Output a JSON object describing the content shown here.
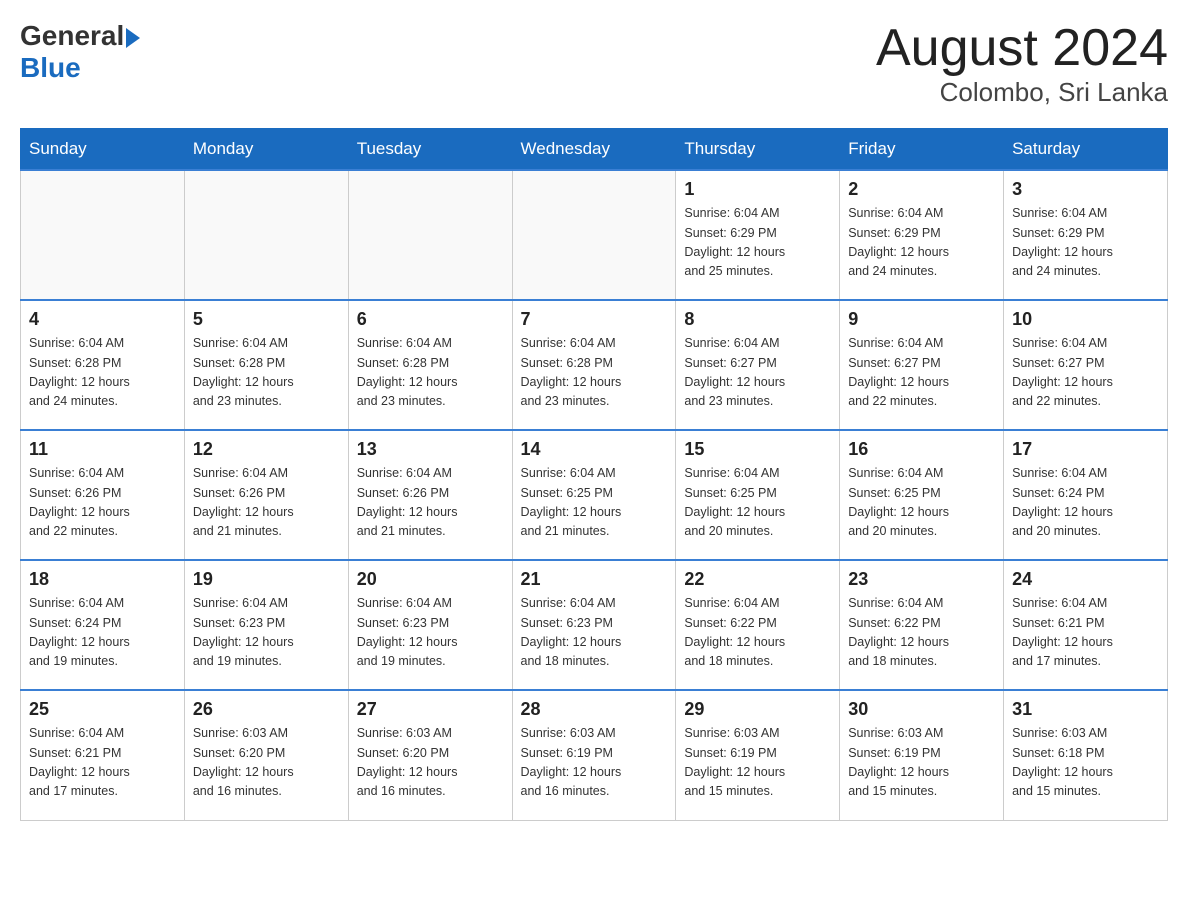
{
  "header": {
    "logo_general": "General",
    "logo_blue": "Blue",
    "title": "August 2024",
    "location": "Colombo, Sri Lanka"
  },
  "days_of_week": [
    "Sunday",
    "Monday",
    "Tuesday",
    "Wednesday",
    "Thursday",
    "Friday",
    "Saturday"
  ],
  "weeks": [
    [
      {
        "day": "",
        "info": ""
      },
      {
        "day": "",
        "info": ""
      },
      {
        "day": "",
        "info": ""
      },
      {
        "day": "",
        "info": ""
      },
      {
        "day": "1",
        "info": "Sunrise: 6:04 AM\nSunset: 6:29 PM\nDaylight: 12 hours\nand 25 minutes."
      },
      {
        "day": "2",
        "info": "Sunrise: 6:04 AM\nSunset: 6:29 PM\nDaylight: 12 hours\nand 24 minutes."
      },
      {
        "day": "3",
        "info": "Sunrise: 6:04 AM\nSunset: 6:29 PM\nDaylight: 12 hours\nand 24 minutes."
      }
    ],
    [
      {
        "day": "4",
        "info": "Sunrise: 6:04 AM\nSunset: 6:28 PM\nDaylight: 12 hours\nand 24 minutes."
      },
      {
        "day": "5",
        "info": "Sunrise: 6:04 AM\nSunset: 6:28 PM\nDaylight: 12 hours\nand 23 minutes."
      },
      {
        "day": "6",
        "info": "Sunrise: 6:04 AM\nSunset: 6:28 PM\nDaylight: 12 hours\nand 23 minutes."
      },
      {
        "day": "7",
        "info": "Sunrise: 6:04 AM\nSunset: 6:28 PM\nDaylight: 12 hours\nand 23 minutes."
      },
      {
        "day": "8",
        "info": "Sunrise: 6:04 AM\nSunset: 6:27 PM\nDaylight: 12 hours\nand 23 minutes."
      },
      {
        "day": "9",
        "info": "Sunrise: 6:04 AM\nSunset: 6:27 PM\nDaylight: 12 hours\nand 22 minutes."
      },
      {
        "day": "10",
        "info": "Sunrise: 6:04 AM\nSunset: 6:27 PM\nDaylight: 12 hours\nand 22 minutes."
      }
    ],
    [
      {
        "day": "11",
        "info": "Sunrise: 6:04 AM\nSunset: 6:26 PM\nDaylight: 12 hours\nand 22 minutes."
      },
      {
        "day": "12",
        "info": "Sunrise: 6:04 AM\nSunset: 6:26 PM\nDaylight: 12 hours\nand 21 minutes."
      },
      {
        "day": "13",
        "info": "Sunrise: 6:04 AM\nSunset: 6:26 PM\nDaylight: 12 hours\nand 21 minutes."
      },
      {
        "day": "14",
        "info": "Sunrise: 6:04 AM\nSunset: 6:25 PM\nDaylight: 12 hours\nand 21 minutes."
      },
      {
        "day": "15",
        "info": "Sunrise: 6:04 AM\nSunset: 6:25 PM\nDaylight: 12 hours\nand 20 minutes."
      },
      {
        "day": "16",
        "info": "Sunrise: 6:04 AM\nSunset: 6:25 PM\nDaylight: 12 hours\nand 20 minutes."
      },
      {
        "day": "17",
        "info": "Sunrise: 6:04 AM\nSunset: 6:24 PM\nDaylight: 12 hours\nand 20 minutes."
      }
    ],
    [
      {
        "day": "18",
        "info": "Sunrise: 6:04 AM\nSunset: 6:24 PM\nDaylight: 12 hours\nand 19 minutes."
      },
      {
        "day": "19",
        "info": "Sunrise: 6:04 AM\nSunset: 6:23 PM\nDaylight: 12 hours\nand 19 minutes."
      },
      {
        "day": "20",
        "info": "Sunrise: 6:04 AM\nSunset: 6:23 PM\nDaylight: 12 hours\nand 19 minutes."
      },
      {
        "day": "21",
        "info": "Sunrise: 6:04 AM\nSunset: 6:23 PM\nDaylight: 12 hours\nand 18 minutes."
      },
      {
        "day": "22",
        "info": "Sunrise: 6:04 AM\nSunset: 6:22 PM\nDaylight: 12 hours\nand 18 minutes."
      },
      {
        "day": "23",
        "info": "Sunrise: 6:04 AM\nSunset: 6:22 PM\nDaylight: 12 hours\nand 18 minutes."
      },
      {
        "day": "24",
        "info": "Sunrise: 6:04 AM\nSunset: 6:21 PM\nDaylight: 12 hours\nand 17 minutes."
      }
    ],
    [
      {
        "day": "25",
        "info": "Sunrise: 6:04 AM\nSunset: 6:21 PM\nDaylight: 12 hours\nand 17 minutes."
      },
      {
        "day": "26",
        "info": "Sunrise: 6:03 AM\nSunset: 6:20 PM\nDaylight: 12 hours\nand 16 minutes."
      },
      {
        "day": "27",
        "info": "Sunrise: 6:03 AM\nSunset: 6:20 PM\nDaylight: 12 hours\nand 16 minutes."
      },
      {
        "day": "28",
        "info": "Sunrise: 6:03 AM\nSunset: 6:19 PM\nDaylight: 12 hours\nand 16 minutes."
      },
      {
        "day": "29",
        "info": "Sunrise: 6:03 AM\nSunset: 6:19 PM\nDaylight: 12 hours\nand 15 minutes."
      },
      {
        "day": "30",
        "info": "Sunrise: 6:03 AM\nSunset: 6:19 PM\nDaylight: 12 hours\nand 15 minutes."
      },
      {
        "day": "31",
        "info": "Sunrise: 6:03 AM\nSunset: 6:18 PM\nDaylight: 12 hours\nand 15 minutes."
      }
    ]
  ]
}
